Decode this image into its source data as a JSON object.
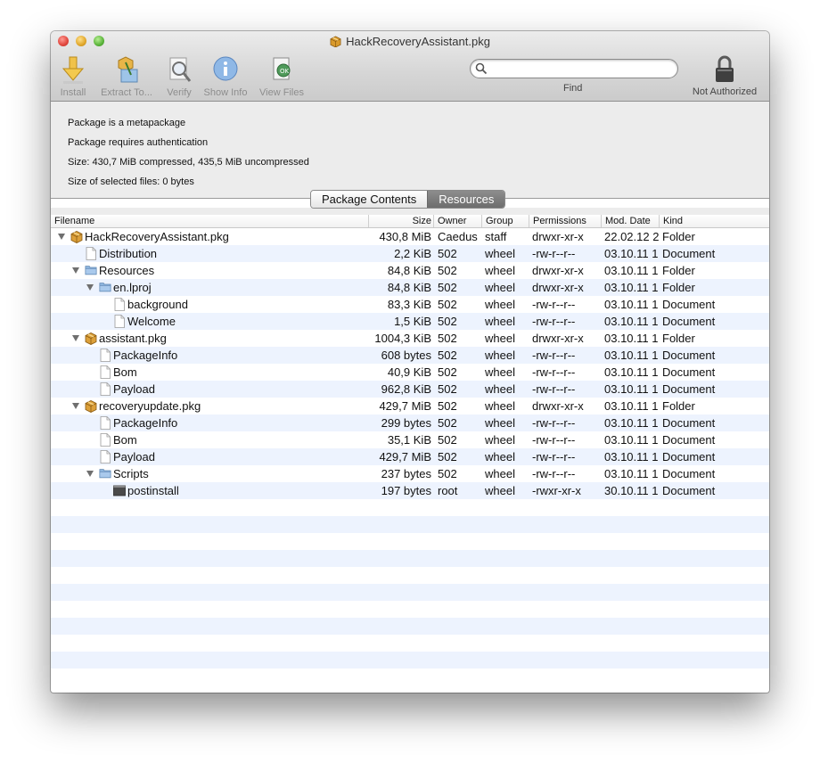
{
  "window": {
    "title": "HackRecoveryAssistant.pkg"
  },
  "toolbar": {
    "items": [
      {
        "label": "Install",
        "icon": "install-arrow-icon"
      },
      {
        "label": "Extract To...",
        "icon": "extract-icon"
      },
      {
        "label": "Verify",
        "icon": "verify-magnifier-icon"
      },
      {
        "label": "Show Info",
        "icon": "info-icon"
      },
      {
        "label": "View Files",
        "icon": "view-files-icon"
      }
    ],
    "search": {
      "placeholder": "",
      "icon": "search-icon"
    },
    "find_label": "Find",
    "auth_label": "Not Authorized",
    "auth_icon": "padlock-icon"
  },
  "info": {
    "line1": "Package is a metapackage",
    "line2": "Package requires authentication",
    "line3": "Size: 430,7 MiB compressed, 435,5 MiB uncompressed",
    "line4": "Size of selected files: 0 bytes"
  },
  "tabs": {
    "package_contents": "Package Contents",
    "resources": "Resources",
    "selected": "resources"
  },
  "table": {
    "headers": {
      "filename": "Filename",
      "size": "Size",
      "owner": "Owner",
      "group": "Group",
      "permissions": "Permissions",
      "mod_date": "Mod. Date",
      "kind": "Kind"
    },
    "rows": [
      {
        "name": "HackRecoveryAssistant.pkg",
        "depth": 0,
        "icon": "package",
        "expanded": true,
        "size": "430,8 MiB",
        "owner": "Caedus",
        "group": "staff",
        "permissions": "drwxr-xr-x",
        "date": "22.02.12 2",
        "kind": "Folder"
      },
      {
        "name": "Distribution",
        "depth": 1,
        "icon": "document",
        "size": "2,2 KiB",
        "owner": "502",
        "group": "wheel",
        "permissions": "-rw-r--r--",
        "date": "03.10.11 1",
        "kind": "Document"
      },
      {
        "name": "Resources",
        "depth": 1,
        "icon": "folder",
        "expanded": true,
        "size": "84,8 KiB",
        "owner": "502",
        "group": "wheel",
        "permissions": "drwxr-xr-x",
        "date": "03.10.11 1",
        "kind": "Folder"
      },
      {
        "name": "en.lproj",
        "depth": 2,
        "icon": "folder",
        "expanded": true,
        "size": "84,8 KiB",
        "owner": "502",
        "group": "wheel",
        "permissions": "drwxr-xr-x",
        "date": "03.10.11 1",
        "kind": "Folder"
      },
      {
        "name": "background",
        "depth": 3,
        "icon": "document",
        "size": "83,3 KiB",
        "owner": "502",
        "group": "wheel",
        "permissions": "-rw-r--r--",
        "date": "03.10.11 1",
        "kind": "Document"
      },
      {
        "name": "Welcome",
        "depth": 3,
        "icon": "document",
        "size": "1,5 KiB",
        "owner": "502",
        "group": "wheel",
        "permissions": "-rw-r--r--",
        "date": "03.10.11 1",
        "kind": "Document"
      },
      {
        "name": "assistant.pkg",
        "depth": 1,
        "icon": "package",
        "expanded": true,
        "size": "1004,3 KiB",
        "owner": "502",
        "group": "wheel",
        "permissions": "drwxr-xr-x",
        "date": "03.10.11 1",
        "kind": "Folder"
      },
      {
        "name": "PackageInfo",
        "depth": 2,
        "icon": "document",
        "size": "608 bytes",
        "owner": "502",
        "group": "wheel",
        "permissions": "-rw-r--r--",
        "date": "03.10.11 1",
        "kind": "Document"
      },
      {
        "name": "Bom",
        "depth": 2,
        "icon": "document",
        "size": "40,9 KiB",
        "owner": "502",
        "group": "wheel",
        "permissions": "-rw-r--r--",
        "date": "03.10.11 1",
        "kind": "Document"
      },
      {
        "name": "Payload",
        "depth": 2,
        "icon": "document",
        "size": "962,8 KiB",
        "owner": "502",
        "group": "wheel",
        "permissions": "-rw-r--r--",
        "date": "03.10.11 1",
        "kind": "Document"
      },
      {
        "name": "recoveryupdate.pkg",
        "depth": 1,
        "icon": "package",
        "expanded": true,
        "size": "429,7 MiB",
        "owner": "502",
        "group": "wheel",
        "permissions": "drwxr-xr-x",
        "date": "03.10.11 1",
        "kind": "Folder"
      },
      {
        "name": "PackageInfo",
        "depth": 2,
        "icon": "document",
        "size": "299 bytes",
        "owner": "502",
        "group": "wheel",
        "permissions": "-rw-r--r--",
        "date": "03.10.11 1",
        "kind": "Document"
      },
      {
        "name": "Bom",
        "depth": 2,
        "icon": "document",
        "size": "35,1 KiB",
        "owner": "502",
        "group": "wheel",
        "permissions": "-rw-r--r--",
        "date": "03.10.11 1",
        "kind": "Document"
      },
      {
        "name": "Payload",
        "depth": 2,
        "icon": "document",
        "size": "429,7 MiB",
        "owner": "502",
        "group": "wheel",
        "permissions": "-rw-r--r--",
        "date": "03.10.11 1",
        "kind": "Document"
      },
      {
        "name": "Scripts",
        "depth": 2,
        "icon": "folder",
        "expanded": true,
        "size": "237 bytes",
        "owner": "502",
        "group": "wheel",
        "permissions": "-rw-r--r--",
        "date": "03.10.11 1",
        "kind": "Document"
      },
      {
        "name": "postinstall",
        "depth": 3,
        "icon": "executable",
        "size": "197 bytes",
        "owner": "root",
        "group": "wheel",
        "permissions": "-rwxr-xr-x",
        "date": "30.10.11 1",
        "kind": "Document"
      }
    ]
  }
}
